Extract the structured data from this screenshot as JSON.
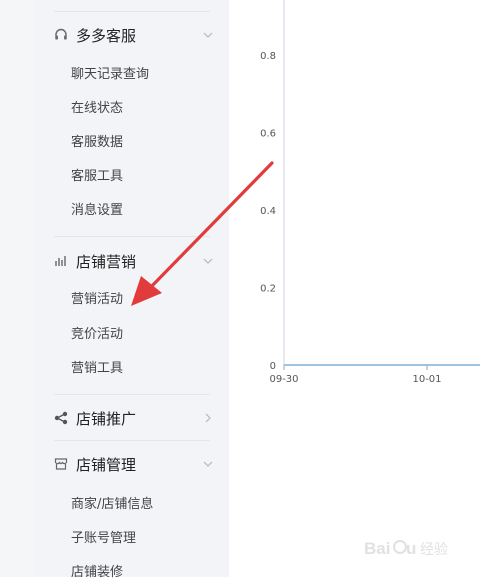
{
  "sidebar": {
    "sections": [
      {
        "label": "多多客服",
        "icon": "headset-icon",
        "expanded": true,
        "items": [
          "聊天记录查询",
          "在线状态",
          "客服数据",
          "客服工具",
          "消息设置"
        ]
      },
      {
        "label": "店铺营销",
        "icon": "bar-chart-icon",
        "expanded": true,
        "items": [
          "营销活动",
          "竞价活动",
          "营销工具"
        ]
      },
      {
        "label": "店铺推广",
        "icon": "share-icon",
        "expanded": false,
        "items": []
      },
      {
        "label": "店铺管理",
        "icon": "store-icon",
        "expanded": true,
        "items": [
          "商家/店铺信息",
          "子账号管理",
          "店铺装修"
        ]
      }
    ]
  },
  "chart_data": {
    "type": "line",
    "x": [
      "09-30",
      "10-01"
    ],
    "y_ticks": [
      "0",
      "0.2",
      "0.4",
      "0.6",
      "0.8"
    ],
    "ylim": [
      0,
      1
    ],
    "series": [
      {
        "values": [
          0,
          0
        ]
      }
    ]
  },
  "annotation": {
    "arrow_color": "#e23b3b"
  },
  "watermark": {
    "text": "经验"
  }
}
